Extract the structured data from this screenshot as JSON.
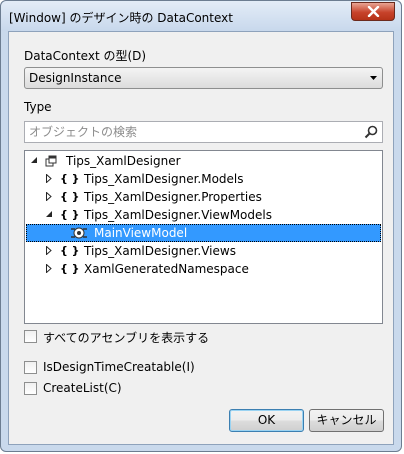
{
  "window": {
    "title": "[Window] のデザイン時の DataContext"
  },
  "datacontext_type": {
    "label": "DataContext の型(D)",
    "selected": "DesignInstance"
  },
  "type_section": {
    "label": "Type",
    "search_placeholder": "オブジェクトの検索"
  },
  "tree": {
    "items": [
      {
        "label": "Tips_XamlDesigner",
        "icon": "namespace-root-icon",
        "expanded": true
      },
      {
        "label": "Tips_XamlDesigner.Models",
        "icon": "namespace-braces-icon",
        "expanded": false
      },
      {
        "label": "Tips_XamlDesigner.Properties",
        "icon": "namespace-braces-icon",
        "expanded": false
      },
      {
        "label": "Tips_XamlDesigner.ViewModels",
        "icon": "namespace-braces-icon",
        "expanded": true
      },
      {
        "label": "MainViewModel",
        "icon": "class-icon",
        "selected": true
      },
      {
        "label": "Tips_XamlDesigner.Views",
        "icon": "namespace-braces-icon",
        "expanded": false
      },
      {
        "label": "XamlGeneratedNamespace",
        "icon": "namespace-braces-icon",
        "expanded": false
      }
    ]
  },
  "options": {
    "show_all_assemblies": "すべてのアセンブリを表示する",
    "is_design_time_creatable": "IsDesignTimeCreatable(I)",
    "create_list": "CreateList(C)"
  },
  "buttons": {
    "ok": "OK",
    "cancel": "キャンセル"
  },
  "colors": {
    "selection": "#3399ff",
    "close_button": "#c7432b",
    "window_frame": "#c9d9ec"
  }
}
